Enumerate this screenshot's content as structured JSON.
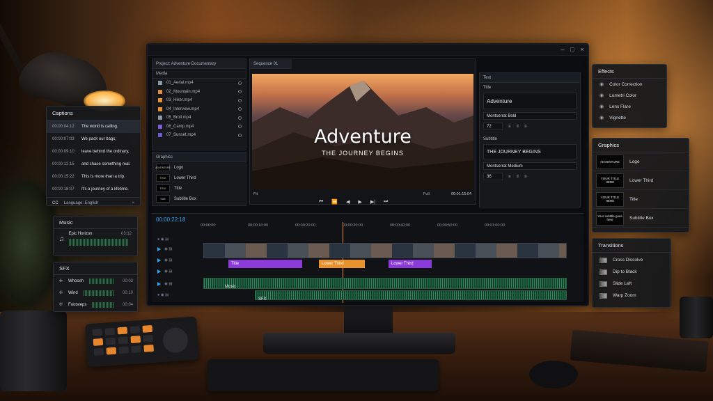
{
  "project_tab": "Project: Adventure Documentary",
  "media": {
    "title": "Media",
    "items": [
      {
        "name": "01_Aerial.mp4",
        "color": "#8a96a4"
      },
      {
        "name": "02_Mountain.mp4",
        "color": "#e08a3a"
      },
      {
        "name": "03_Hiker.mp4",
        "color": "#e8902a"
      },
      {
        "name": "04_Interview.mp4",
        "color": "#e8902a"
      },
      {
        "name": "05_Broll.mp4",
        "color": "#8a96a4"
      },
      {
        "name": "06_Camp.mp4",
        "color": "#7a5ad8"
      },
      {
        "name": "07_Sunset.mp4",
        "color": "#6a58d0"
      }
    ]
  },
  "graphics_mini": {
    "title": "Graphics",
    "items": [
      {
        "label": "Logo",
        "thumb": "ADVENTURE"
      },
      {
        "label": "Lower Third",
        "thumb": "TITLE"
      },
      {
        "label": "Title",
        "thumb": "TITLE"
      },
      {
        "label": "Subtitle Box",
        "thumb": "SUB"
      }
    ]
  },
  "sequence_tab": "Sequence 01",
  "preview": {
    "title": "Adventure",
    "subtitle": "THE JOURNEY BEGINS",
    "fit": "Full",
    "fit_left": "Fit",
    "timecode": "00:01:15:04"
  },
  "text_panel": {
    "title": "Text",
    "title_section": "Title",
    "title_value": "Adventure",
    "title_font": "Montserrat Bold",
    "title_size": "72",
    "subtitle_section": "Subtitle",
    "subtitle_value": "THE JOURNEY BEGINS",
    "subtitle_font": "Montserrat Medium",
    "subtitle_size": "36"
  },
  "timeline": {
    "timecode": "00:00:22:18",
    "ruler": [
      "00:00:00",
      "00:00:10:00",
      "00:00:20:00",
      "00:00:30:00",
      "00:00:40:00",
      "00:00:50:00",
      "00:01:00:00"
    ],
    "clips": [
      {
        "label": "Title",
        "color": "#8a3ad8"
      },
      {
        "label": "Lower Third",
        "color": "#e8902a"
      },
      {
        "label": "Lower Third",
        "color": "#8a3ad8"
      }
    ],
    "audio": [
      "Music",
      "SFX"
    ]
  },
  "captions": {
    "title": "Captions",
    "items": [
      {
        "time": "00:00:04:12",
        "text": "The world is calling."
      },
      {
        "time": "00:00:07:03",
        "text": "We pack our bags,"
      },
      {
        "time": "00:00:09:10",
        "text": "leave behind the ordinary,"
      },
      {
        "time": "00:00:12:15",
        "text": "and chase something real."
      },
      {
        "time": "00:00:15:22",
        "text": "This is more than a trip."
      },
      {
        "time": "00:00:18:07",
        "text": "It's a journey of a lifetime."
      }
    ],
    "cc": "CC",
    "language": "Language: English"
  },
  "music": {
    "title": "Music",
    "track": "Epic Horizon",
    "duration": "03:12"
  },
  "sfx": {
    "title": "SFX",
    "items": [
      {
        "name": "Whoosh",
        "duration": "00:03"
      },
      {
        "name": "Wind",
        "duration": "00:10"
      },
      {
        "name": "Footsteps",
        "duration": "00:04"
      }
    ]
  },
  "effects": {
    "title": "Effects",
    "items": [
      "Color Correction",
      "Lumetri Color",
      "Lens Flare",
      "Vignette"
    ]
  },
  "graphics": {
    "title": "Graphics",
    "items": [
      {
        "label": "Logo",
        "thumb": "ADVENTURE"
      },
      {
        "label": "Lower Third",
        "thumb": "YOUR TITLE HERE"
      },
      {
        "label": "Title",
        "thumb": "YOUR TITLE HERE"
      },
      {
        "label": "Subtitle Box",
        "thumb": "Your subtitle goes here"
      }
    ]
  },
  "transitions": {
    "title": "Transitions",
    "items": [
      "Cross Dissolve",
      "Dip to Black",
      "Slide Left",
      "Warp Zoom"
    ]
  }
}
